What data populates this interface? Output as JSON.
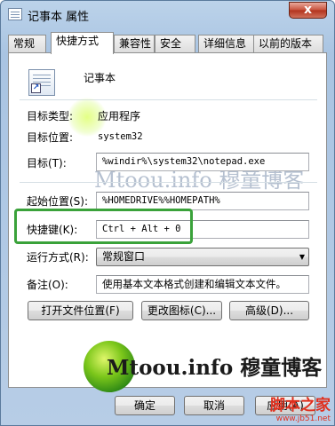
{
  "window": {
    "title": "记事本 属性",
    "close_label": "x"
  },
  "tabs": [
    "常规",
    "快捷方式",
    "兼容性",
    "安全",
    "详细信息",
    "以前的版本"
  ],
  "active_tab": "快捷方式",
  "app": {
    "name": "记事本"
  },
  "fields": {
    "target_type": {
      "label": "目标类型:",
      "value": "应用程序"
    },
    "target_location": {
      "label": "目标位置:",
      "value": "system32"
    },
    "target": {
      "label": "目标(T):",
      "value": "%windir%\\system32\\notepad.exe"
    },
    "start_in": {
      "label": "起始位置(S):",
      "value": "%HOMEDRIVE%%HOMEPATH%"
    },
    "shortcut_key": {
      "label": "快捷键(K):",
      "value": "Ctrl + Alt + 0"
    },
    "run": {
      "label": "运行方式(R):",
      "value": "常规窗口"
    },
    "comment": {
      "label": "备注(O):",
      "value": "使用基本文本格式创建和编辑文本文件。"
    }
  },
  "buttons": {
    "open_location": "打开文件位置(F)",
    "change_icon": "更改图标(C)...",
    "advanced": "高级(D)...",
    "ok": "确定",
    "cancel": "取消",
    "apply": "应用(A)"
  },
  "watermark": {
    "text": "Mtoou.info 穆童博客"
  },
  "site_mark": {
    "name": "脚本之家",
    "url": "www.jb51.net"
  },
  "colors": {
    "highlight": "#3aa23a",
    "site_mark": "#e0301e",
    "logo_green": "#7bc61a"
  }
}
